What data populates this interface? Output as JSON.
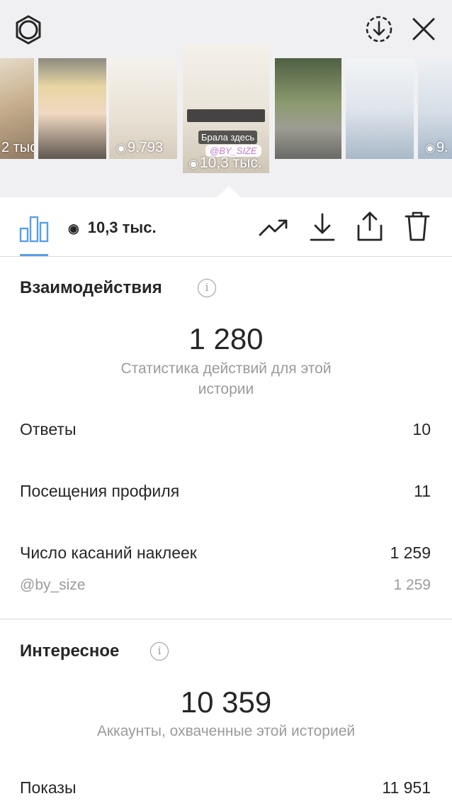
{
  "top": {
    "thumbs": [
      {
        "views": "2 тыс",
        "palette": [
          "#d9c6a6",
          "#8f7a62"
        ]
      },
      {
        "views": "",
        "palette": [
          "#a9a29a",
          "#5e5a55"
        ]
      },
      {
        "views": "9.793",
        "palette": [
          "#efeae1",
          "#d9d1c4"
        ]
      },
      {
        "views": "10,3 тыс.",
        "palette": [
          "#eeeae2",
          "#d5cdbf"
        ]
      },
      {
        "views": "",
        "palette": [
          "#5f6d52",
          "#9aa08c"
        ]
      },
      {
        "views": "",
        "palette": [
          "#e7eaee",
          "#b7c3cf"
        ]
      },
      {
        "views": "9.",
        "palette": [
          "#e6e9ee",
          "#b8c4d0"
        ]
      }
    ],
    "selected_caption": {
      "brala": "Брала здесь",
      "mention": "@BY_SIZE"
    }
  },
  "toolbar": {
    "views": "10,3 тыс."
  },
  "interactions": {
    "title": "Взаимодействия",
    "total": "1 280",
    "caption": "Статистика действий для этой истории",
    "rows": [
      {
        "label": "Ответы",
        "value": "10"
      },
      {
        "label": "Посещения профиля",
        "value": "11"
      },
      {
        "label": "Число касаний наклеек",
        "value": "1 259"
      }
    ],
    "sub_row": {
      "label": "@by_size",
      "value": "1 259"
    }
  },
  "discovery": {
    "title": "Интересное",
    "total": "10 359",
    "caption": "Аккаунты, охваченные этой историей",
    "rows": [
      {
        "label": "Показы",
        "value": "11 951"
      }
    ]
  },
  "colors": {
    "accent": "#5aa0e6",
    "text": "#262626",
    "muted": "#9b9b9b",
    "divider": "#dbdbdb"
  },
  "icons": {
    "settings": "settings-icon",
    "download_circle": "download-circle-icon",
    "close": "close-icon",
    "bar_chart": "bar-chart-icon",
    "eye": "eye-icon",
    "trend": "trending-up-icon",
    "download": "download-icon",
    "share": "share-icon",
    "trash": "trash-icon",
    "info": "info-icon"
  }
}
